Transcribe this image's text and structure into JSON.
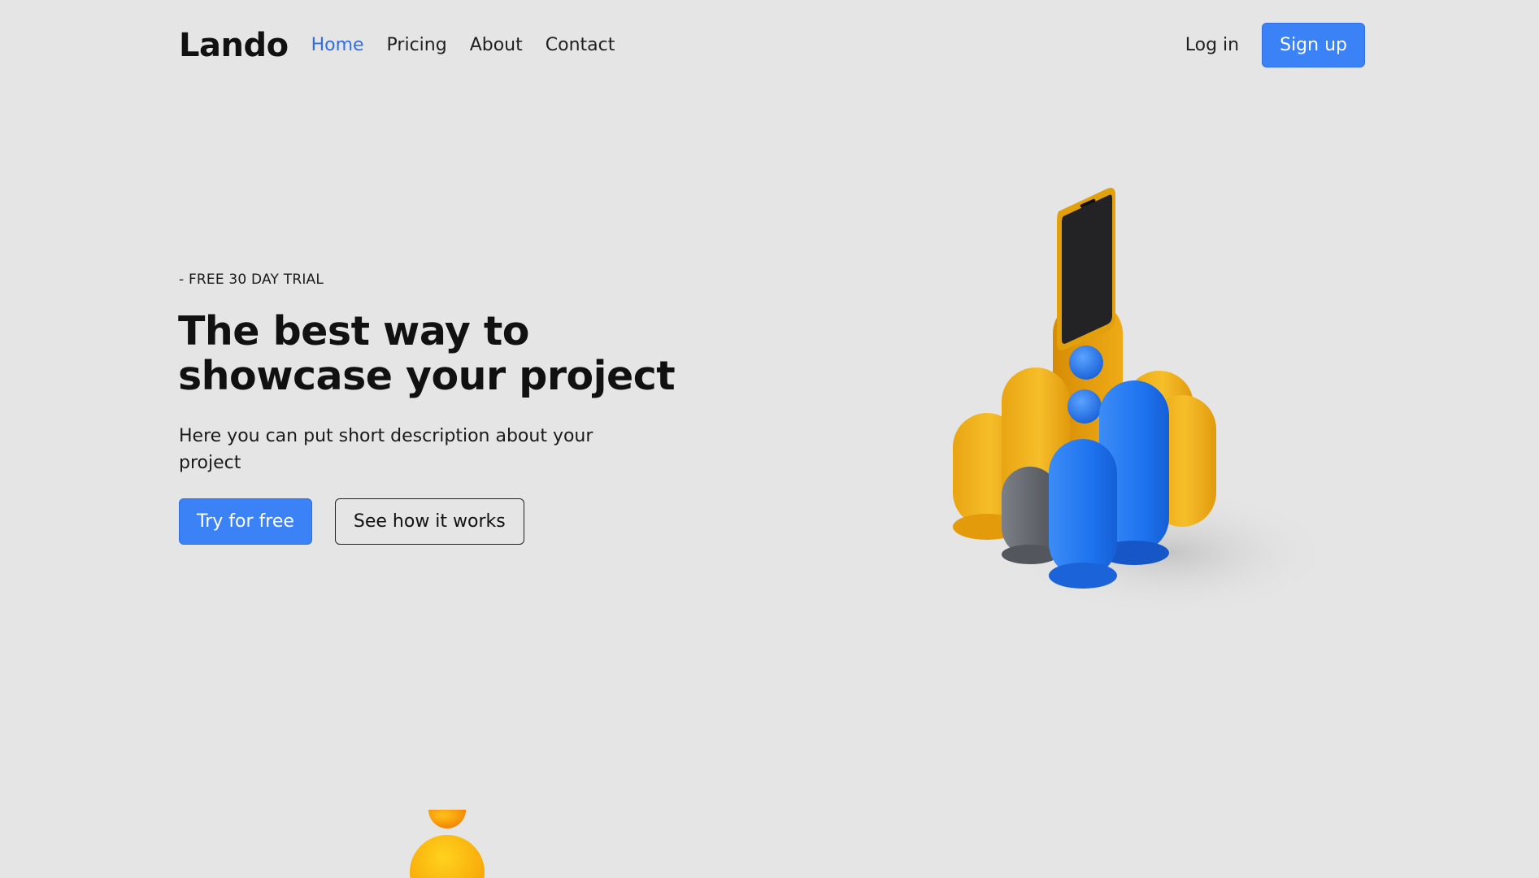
{
  "nav": {
    "brand": "Lando",
    "links": [
      {
        "label": "Home",
        "active": true
      },
      {
        "label": "Pricing",
        "active": false
      },
      {
        "label": "About",
        "active": false
      },
      {
        "label": "Contact",
        "active": false
      }
    ],
    "login_label": "Log in",
    "signup_label": "Sign up"
  },
  "hero": {
    "eyebrow": "- FREE 30 DAY TRIAL",
    "headline_line1": "The best way to",
    "headline_line2": "showcase your project",
    "description": "Here you can put short description about your project",
    "primary_cta": "Try for free",
    "secondary_cta": "See how it works"
  },
  "colors": {
    "background": "#e5e5e5",
    "accent": "#3b82f6",
    "active_link": "#2f6fe0",
    "illustration_yellow": "#f2b01e",
    "illustration_blue": "#1f74f0",
    "illustration_gray": "#5f6369"
  },
  "icons": {
    "hero_illustration": "phone-with-cylinders-illustration",
    "bottom_illustration": "orange-spheres-illustration"
  }
}
